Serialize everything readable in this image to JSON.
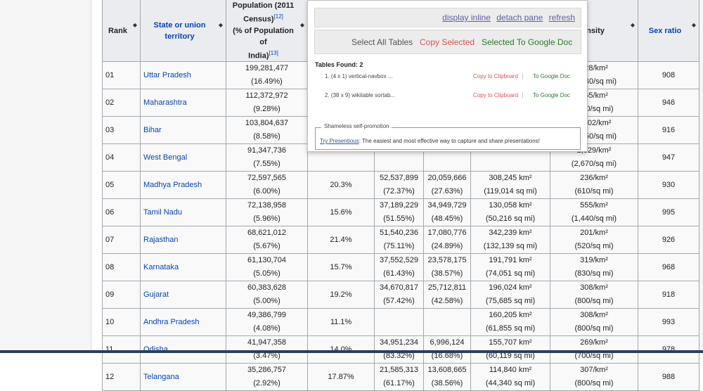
{
  "table": {
    "headers": {
      "rank": "Rank",
      "state": "State or union territory",
      "population_l1": "Population (2011",
      "population_l2": "Census)",
      "population_ref1": "[12]",
      "population_l3": "(% of Population of",
      "population_l4": "India)",
      "population_ref2": "[13]",
      "density": "Density",
      "sex_ratio": "Sex ratio",
      "sort_glyph": "◆"
    },
    "rows": [
      {
        "rank": "01",
        "state": "Uttar Pradesh",
        "pop": "199,281,477",
        "pop_pct": "(16.49%)",
        "growth": "",
        "rural": "",
        "rural_pct": "",
        "urban": "",
        "urban_pct": "",
        "area": "",
        "area_mi": "",
        "density": "828/km²",
        "density_mi": "(2,140/sq mi)",
        "sex_ratio": "908"
      },
      {
        "rank": "02",
        "state": "Maharashtra",
        "pop": "112,372,972",
        "pop_pct": "(9.28%)",
        "growth": "",
        "rural": "",
        "rural_pct": "",
        "urban": "",
        "urban_pct": "",
        "area": "",
        "area_mi": "",
        "density": "365/km²",
        "density_mi": "(950/sq mi)",
        "sex_ratio": "946"
      },
      {
        "rank": "03",
        "state": "Bihar",
        "pop": "103,804,637",
        "pop_pct": "(8.58%)",
        "growth": "",
        "rural": "",
        "rural_pct": "",
        "urban": "",
        "urban_pct": "",
        "area": "",
        "area_mi": "",
        "density": "1,102/km²",
        "density_mi": "(2,850/sq mi)",
        "sex_ratio": "916"
      },
      {
        "rank": "04",
        "state": "West Bengal",
        "pop": "91,347,736",
        "pop_pct": "(7.55%)",
        "growth": "",
        "rural": "",
        "rural_pct": "",
        "urban": "",
        "urban_pct": "",
        "area": "",
        "area_mi": "",
        "density": "1,029/km²",
        "density_mi": "(2,670/sq mi)",
        "sex_ratio": "947"
      },
      {
        "rank": "05",
        "state": "Madhya Pradesh",
        "pop": "72,597,565",
        "pop_pct": "(6.00%)",
        "growth": "20.3%",
        "rural": "52,537,899",
        "rural_pct": "(72.37%)",
        "urban": "20,059,666",
        "urban_pct": "(27.63%)",
        "area": "308,245 km²",
        "area_mi": "(119,014 sq mi)",
        "density": "236/km²",
        "density_mi": "(610/sq mi)",
        "sex_ratio": "930"
      },
      {
        "rank": "06",
        "state": "Tamil Nadu",
        "pop": "72,138,958",
        "pop_pct": "(5.96%)",
        "growth": "15.6%",
        "rural": "37,189,229",
        "rural_pct": "(51.55%)",
        "urban": "34,949,729",
        "urban_pct": "(48.45%)",
        "area": "130,058 km²",
        "area_mi": "(50,216 sq mi)",
        "density": "555/km²",
        "density_mi": "(1,440/sq mi)",
        "sex_ratio": "995"
      },
      {
        "rank": "07",
        "state": "Rajasthan",
        "pop": "68,621,012",
        "pop_pct": "(5.67%)",
        "growth": "21.4%",
        "rural": "51,540,236",
        "rural_pct": "(75.11%)",
        "urban": "17,080,776",
        "urban_pct": "(24.89%)",
        "area": "342,239 km²",
        "area_mi": "(132,139 sq mi)",
        "density": "201/km²",
        "density_mi": "(520/sq mi)",
        "sex_ratio": "926"
      },
      {
        "rank": "08",
        "state": "Karnataka",
        "pop": "61,130,704",
        "pop_pct": "(5.05%)",
        "growth": "15.7%",
        "rural": "37,552,529",
        "rural_pct": "(61.43%)",
        "urban": "23,578,175",
        "urban_pct": "(38.57%)",
        "area": "191,791 km²",
        "area_mi": "(74,051 sq mi)",
        "density": "319/km²",
        "density_mi": "(830/sq mi)",
        "sex_ratio": "968"
      },
      {
        "rank": "09",
        "state": "Gujarat",
        "pop": "60,383,628",
        "pop_pct": "(5.00%)",
        "growth": "19.2%",
        "rural": "34,670,817",
        "rural_pct": "(57.42%)",
        "urban": "25,712,811",
        "urban_pct": "(42.58%)",
        "area": "196,024 km²",
        "area_mi": "(75,685 sq mi)",
        "density": "308/km²",
        "density_mi": "(800/sq mi)",
        "sex_ratio": "918"
      },
      {
        "rank": "10",
        "state": "Andhra Pradesh",
        "pop": "49,386,799",
        "pop_pct": "(4.08%)",
        "growth": "11.1%",
        "rural": "",
        "rural_pct": "",
        "urban": "",
        "urban_pct": "",
        "area": "160,205 km²",
        "area_mi": "(61,855 sq mi)",
        "density": "308/km²",
        "density_mi": "(800/sq mi)",
        "sex_ratio": "993"
      },
      {
        "rank": "11",
        "state": "Odisha",
        "pop": "41,947,358",
        "pop_pct": "(3.47%)",
        "growth": "14.0%",
        "rural": "34,951,234",
        "rural_pct": "(83.32%)",
        "urban": "6,996,124",
        "urban_pct": "(16.68%)",
        "area": "155,707 km²",
        "area_mi": "(60,119 sq mi)",
        "density": "269/km²",
        "density_mi": "(700/sq mi)",
        "sex_ratio": "978"
      },
      {
        "rank": "12",
        "state": "Telangana",
        "pop": "35,286,757",
        "pop_pct": "(2.92%)",
        "growth": "17.87%",
        "rural": "21,585,313",
        "rural_pct": "(61.17%)",
        "urban": "13,608,665",
        "urban_pct": "(38.56%)",
        "area": "114,840 km²",
        "area_mi": "(44,340 sq mi)",
        "density": "307/km²",
        "density_mi": "(800/sq mi)",
        "sex_ratio": "988"
      }
    ]
  },
  "overlay": {
    "links": [
      "display inline",
      "detach pane",
      "refresh"
    ],
    "select_all": "Select All Tables",
    "copy_selected": "Copy Selected",
    "selected_to_google": "Selected To Google Doc",
    "tables_found": "Tables Found: 2",
    "found": [
      {
        "index": "1.",
        "desc": "(4 x 1) vertical-navbox ...",
        "copy": "Copy to Clipboard",
        "google": "To Google Doc"
      },
      {
        "index": "2.",
        "desc": "(38 x 9) wikitable sortab...",
        "copy": "Copy to Clipboard",
        "google": "To Google Doc"
      }
    ],
    "promo_legend": "Shameless self-promotion",
    "promo_link": "Try Presentious",
    "promo_text": ": The easiest and most effective way to capture and share presentations!"
  },
  "colors": {
    "link": "#0645ad",
    "copy_red": "#d9534f",
    "google_green": "#2a7a2a",
    "header_bg": "#eaecf0"
  }
}
